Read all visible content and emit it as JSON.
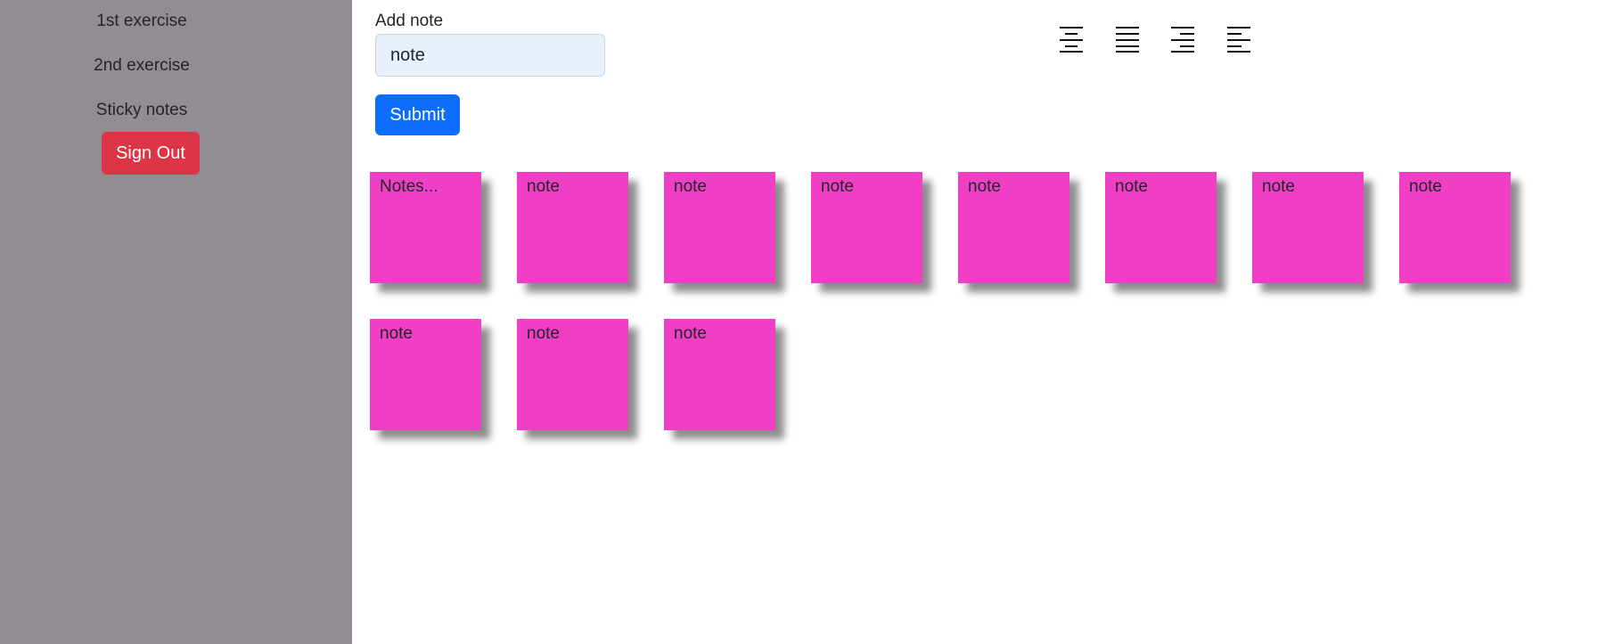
{
  "sidebar": {
    "items": [
      {
        "label": "1st exercise"
      },
      {
        "label": "2nd exercise"
      },
      {
        "label": "Sticky notes"
      }
    ],
    "sign_out_label": "Sign Out"
  },
  "form": {
    "label": "Add note",
    "input_value": "note",
    "submit_label": "Submit"
  },
  "toolbar": {
    "alignment_icons": [
      "align-center-icon",
      "align-justify-icon",
      "align-right-icon",
      "align-left-icon"
    ]
  },
  "notes": [
    {
      "text": "Notes..."
    },
    {
      "text": "note"
    },
    {
      "text": "note"
    },
    {
      "text": "note"
    },
    {
      "text": "note"
    },
    {
      "text": "note"
    },
    {
      "text": "note"
    },
    {
      "text": "note"
    },
    {
      "text": "note"
    },
    {
      "text": "note"
    },
    {
      "text": "note"
    }
  ],
  "colors": {
    "sidebar_bg": "#938c92",
    "note_bg": "#f03fc5",
    "submit_bg": "#0d6efd",
    "sign_out_bg": "#dc3545"
  }
}
